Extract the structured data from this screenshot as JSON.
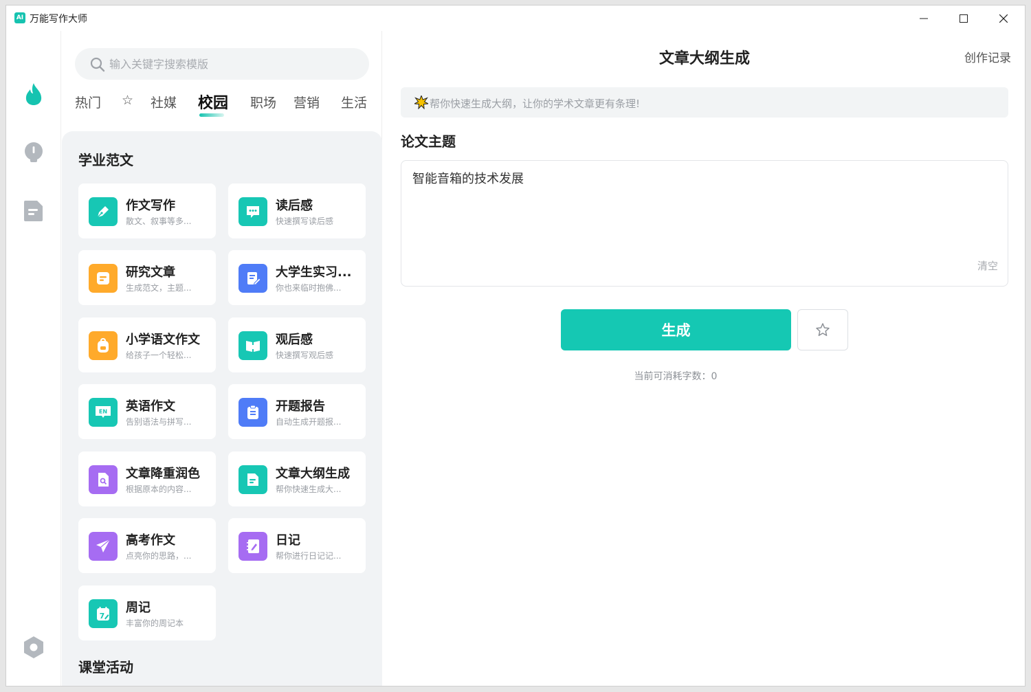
{
  "window": {
    "app_logo": "AI",
    "title": "万能写作大师"
  },
  "rail": {
    "items": [
      {
        "icon": "flame-icon",
        "color": "#16c3b0",
        "active": true
      },
      {
        "icon": "bulb-icon",
        "color": "#b3b8be"
      },
      {
        "icon": "document-icon",
        "color": "#b3b8be"
      },
      {
        "icon": "settings-icon",
        "color": "#b3b8be"
      }
    ]
  },
  "search": {
    "placeholder": "输入关键字搜索模版"
  },
  "tabs": [
    {
      "label": "热门"
    },
    {
      "label": "☆"
    },
    {
      "label": "社媒"
    },
    {
      "label": "校园",
      "active": true
    },
    {
      "label": "职场"
    },
    {
      "label": "营销"
    },
    {
      "label": "生活"
    }
  ],
  "sections": {
    "academic": "学业范文",
    "class_activity": "课堂活动"
  },
  "cards": [
    {
      "title": "作文写作",
      "desc": "散文、叙事等多...",
      "icon": "pen-icon",
      "color": "#17c7b4"
    },
    {
      "title": "读后感",
      "desc": "快速撰写读后感",
      "icon": "chat-bubble-icon",
      "color": "#17c7b4"
    },
    {
      "title": "研究文章",
      "desc": "生成范文，主题...",
      "icon": "note-icon",
      "color": "#ffaa2b"
    },
    {
      "title": "大学生实习...",
      "desc": "你也来临时抱佛...",
      "icon": "edit-document-icon",
      "color": "#4f7cf7"
    },
    {
      "title": "小学语文作文",
      "desc": "给孩子一个轻松...",
      "icon": "backpack-icon",
      "color": "#ffaa2b"
    },
    {
      "title": "观后感",
      "desc": "快速撰写观后感",
      "icon": "open-book-icon",
      "color": "#17c7b4"
    },
    {
      "title": "英语作文",
      "desc": "告别语法与拼写...",
      "icon": "english-icon",
      "color": "#17c7b4"
    },
    {
      "title": "开题报告",
      "desc": "自动生成开题报...",
      "icon": "clipboard-icon",
      "color": "#4f7cf7"
    },
    {
      "title": "文章降重润色",
      "desc": "根据原本的内容...",
      "icon": "search-document-icon",
      "color": "#a66cf2"
    },
    {
      "title": "文章大纲生成",
      "desc": "帮你快速生成大...",
      "icon": "outline-document-icon",
      "color": "#17c7b4"
    },
    {
      "title": "高考作文",
      "desc": "点亮你的思路，...",
      "icon": "paper-plane-icon",
      "color": "#a66cf2"
    },
    {
      "title": "日记",
      "desc": "帮你进行日记记...",
      "icon": "diary-icon",
      "color": "#a66cf2"
    },
    {
      "title": "周记",
      "desc": "丰富你的周记本",
      "icon": "calendar-icon",
      "color": "#17c7b4"
    }
  ],
  "main": {
    "title": "文章大纲生成",
    "history_link": "创作记录",
    "tip": "帮你快速生成大纲，让你的学术文章更有条理!",
    "field_label": "论文主题",
    "input_value": "智能音箱的技术发展",
    "clear_label": "清空",
    "generate_label": "生成",
    "quota_text": "当前可消耗字数：0"
  },
  "colors": {
    "accent": "#15c8b3",
    "panel_bg": "#f1f3f5"
  }
}
